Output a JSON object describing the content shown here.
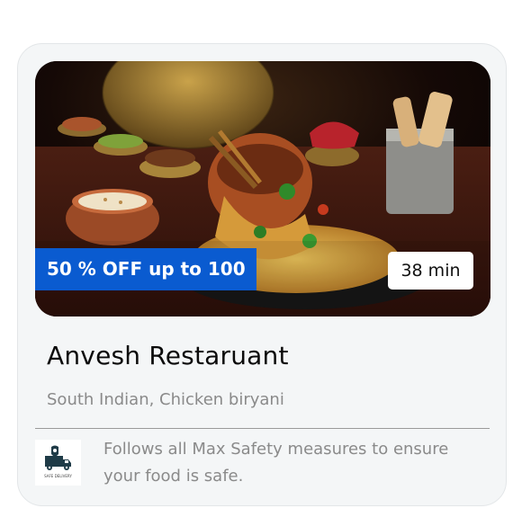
{
  "card": {
    "image": {
      "alt": "Biryani dish served on a dark table"
    },
    "offer_label": "50 % OFF up to 100",
    "delivery_time": "38 min",
    "restaurant_name": "Anvesh Restaruant",
    "cuisines": "South Indian, Chicken biryani",
    "safety": {
      "icon": "safe-delivery-truck-icon",
      "logo_text": "SAFE DELIVERY",
      "message": "Follows all Max Safety measures to ensure your food is safe."
    }
  },
  "colors": {
    "offer_badge": "#0a5bd0",
    "card_background": "#f4f6f7",
    "secondary_text": "#8a8a8a"
  }
}
